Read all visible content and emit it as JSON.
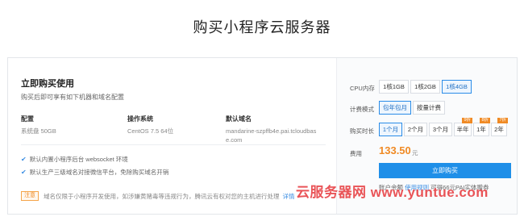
{
  "page": {
    "title": "购买小程序云服务器"
  },
  "left": {
    "title": "立即购买使用",
    "desc": "购买后即可享有如下机器和域名配置",
    "specs": {
      "config": {
        "label": "配置",
        "value": "系统盘 50GB"
      },
      "os": {
        "label": "操作系统",
        "value": "CentOS 7.5 64位"
      },
      "domain": {
        "label": "默认域名",
        "value": "mandarine-szpffb4e.pai.tcloudbase.com"
      }
    },
    "features": [
      "默认内置小程序后台 websocket 环境",
      "默认生产三级域名对接微信平台，免除购买域名开销"
    ],
    "notice": {
      "tag": "注意",
      "text": "域名仅限于小程序开发使用，如涉嫌黄赌毒等违规行为，腾讯云有权对您的主机进行处理",
      "link": "详情"
    }
  },
  "right": {
    "cpu": {
      "label": "CPU内存",
      "options": [
        "1核1GB",
        "1核2GB",
        "1核4GB"
      ],
      "selected": "1核4GB"
    },
    "billing": {
      "label": "计费模式",
      "options": [
        "包年包月",
        "按量计费"
      ],
      "selected": "包年包月"
    },
    "duration": {
      "label": "购买时长",
      "options": [
        "1个月",
        "2个月",
        "3个月",
        "半年",
        "1年",
        "2年"
      ],
      "badges": {
        "半年": "9折",
        "1年": "8折",
        "2年": "7折"
      },
      "selected": "1个月"
    },
    "fee": {
      "label": "费用",
      "price": "133.50",
      "unit": "元"
    },
    "buy_button": "立即购买",
    "coupon": {
      "prefix": "账户余额 ",
      "link": "使用规则",
      "suffix": "  可得66元PAI实体赠券"
    }
  },
  "watermark": "云服务器网 www.yuntue.com",
  "colors": {
    "accent": "#1f8fe8",
    "price": "#f08a24",
    "watermark": "#e8464a"
  }
}
